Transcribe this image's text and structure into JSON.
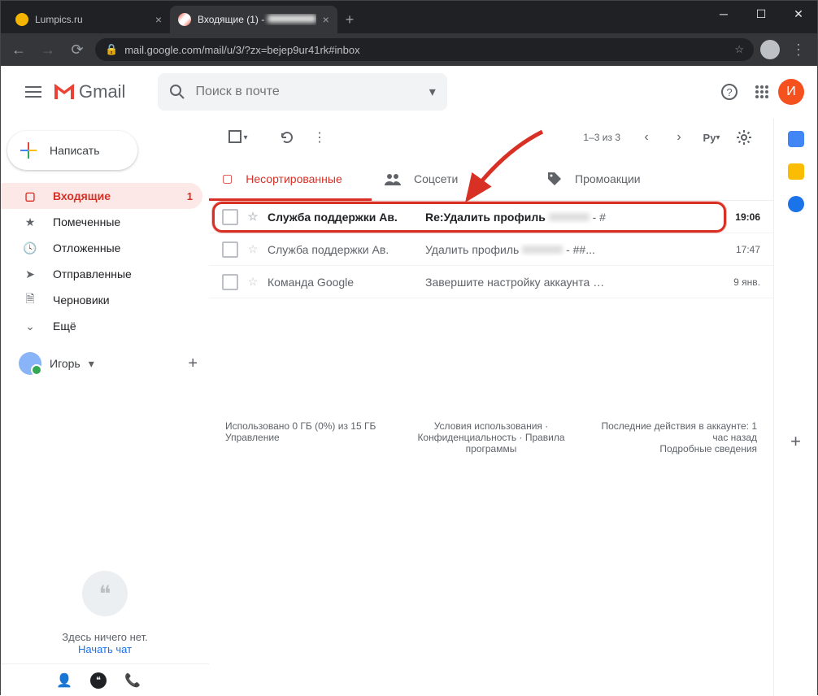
{
  "browser": {
    "tabs": [
      {
        "title": "Lumpics.ru",
        "favicon": "#f4b400"
      },
      {
        "title": "Входящие (1) - ",
        "favicon": "gmail",
        "active": true
      }
    ],
    "url": "mail.google.com/mail/u/3/?zx=bejep9ur41rk#inbox"
  },
  "header": {
    "product": "Gmail",
    "search_placeholder": "Поиск в почте",
    "avatar_letter": "И"
  },
  "compose_label": "Написать",
  "sidebar": [
    {
      "icon": "inbox",
      "label": "Входящие",
      "count": "1",
      "active": true
    },
    {
      "icon": "star",
      "label": "Помеченные"
    },
    {
      "icon": "clock",
      "label": "Отложенные"
    },
    {
      "icon": "send",
      "label": "Отправленные"
    },
    {
      "icon": "file",
      "label": "Черновики"
    },
    {
      "icon": "more",
      "label": "Ещё"
    }
  ],
  "user": {
    "name": "Игорь"
  },
  "hangouts": {
    "empty": "Здесь ничего нет.",
    "start": "Начать чат"
  },
  "toolbar": {
    "range": "1–3 из 3",
    "lang": "Ру"
  },
  "category_tabs": [
    {
      "label": "Несортированные",
      "active": true
    },
    {
      "label": "Соцсети"
    },
    {
      "label": "Промоакции"
    }
  ],
  "emails": [
    {
      "sender": "Служба поддержки Ав.",
      "subject": "Re:Удалить профиль",
      "snippet": " - #",
      "time": "19:06",
      "unread": true,
      "highlight": true
    },
    {
      "sender": "Служба поддержки Ав.",
      "subject": "Удалить профиль",
      "snippet": " - ##...",
      "time": "17:47"
    },
    {
      "sender": "Команда Google",
      "subject": "Завершите настройку аккаунта …",
      "snippet": "",
      "time": "9 янв."
    }
  ],
  "footer": {
    "storage": "Использовано 0 ГБ (0%) из 15 ГБ",
    "manage": "Управление",
    "terms": "Условия использования · Конфиденциальность · Правила программы",
    "activity": "Последние действия в аккаунте: 1 час назад",
    "details": "Подробные сведения"
  }
}
